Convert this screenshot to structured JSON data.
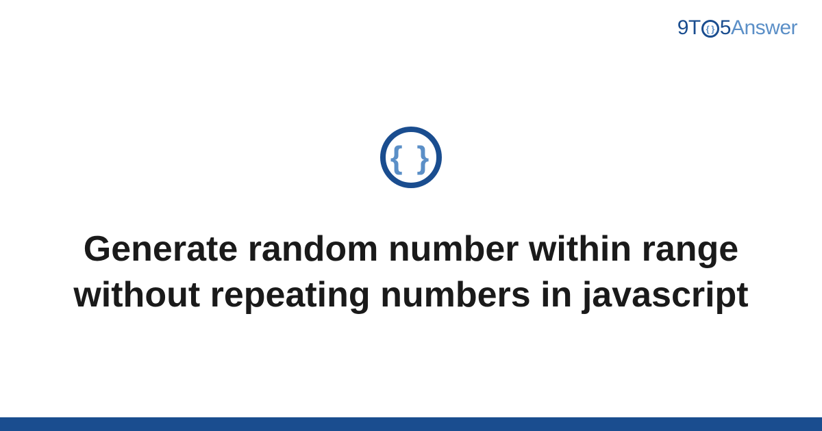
{
  "logo": {
    "part1": "9T",
    "circle_inner": "{ }",
    "part2": "5",
    "part3": "Answer"
  },
  "icon": {
    "name": "curly-braces-icon",
    "glyph": "{ }"
  },
  "title": "Generate random number within range without repeating numbers in javascript",
  "colors": {
    "primary": "#1a4d8f",
    "secondary": "#5b8fc7",
    "text": "#1a1a1a"
  }
}
